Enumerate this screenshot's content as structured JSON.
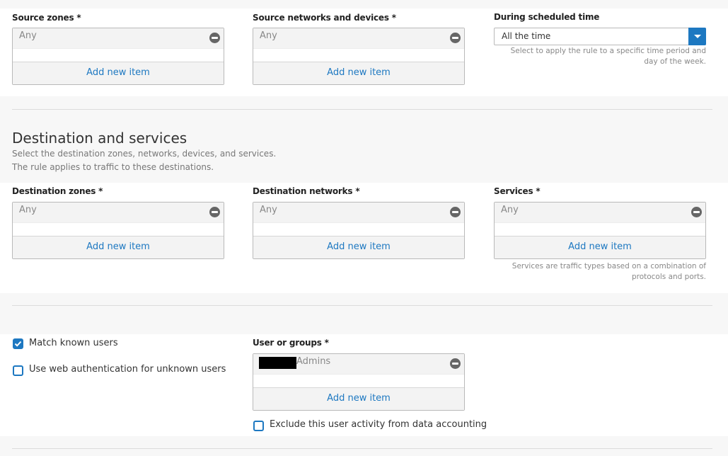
{
  "source": {
    "zones": {
      "label": "Source zones *",
      "item": "Any",
      "add_label": "Add new item"
    },
    "networks": {
      "label": "Source networks and devices *",
      "item": "Any",
      "add_label": "Add new item"
    },
    "schedule": {
      "label": "During scheduled time",
      "value": "All the time",
      "help_line1": "Select to apply the rule to a specific time period and",
      "help_line2": "day of the week."
    }
  },
  "destination": {
    "title": "Destination and services",
    "desc_line1": "Select the destination zones, networks, devices, and services.",
    "desc_line2": "The rule applies to traffic to these destinations.",
    "zones": {
      "label": "Destination zones *",
      "item": "Any",
      "add_label": "Add new item"
    },
    "networks": {
      "label": "Destination networks *",
      "item": "Any",
      "add_label": "Add new item"
    },
    "services": {
      "label": "Services *",
      "item": "Any",
      "add_label": "Add new item",
      "help_line1": "Services are traffic types based on a combination of",
      "help_line2": "protocols and ports."
    }
  },
  "users": {
    "match_known_users": {
      "label": "Match known users",
      "checked": true
    },
    "web_auth": {
      "label": "Use web authentication for unknown users",
      "checked": false
    },
    "groups": {
      "label": "User or groups *",
      "item": "Admins",
      "add_label": "Add new item"
    },
    "exclude": {
      "label": "Exclude this user activity from data accounting",
      "checked": false
    }
  },
  "colors": {
    "accent": "#1d78c1",
    "background": "#f7f7f7",
    "panel": "#ffffff"
  },
  "icons": {
    "remove": "minus-circle-icon",
    "dropdown": "chevron-down-icon",
    "check": "checkmark-icon"
  }
}
